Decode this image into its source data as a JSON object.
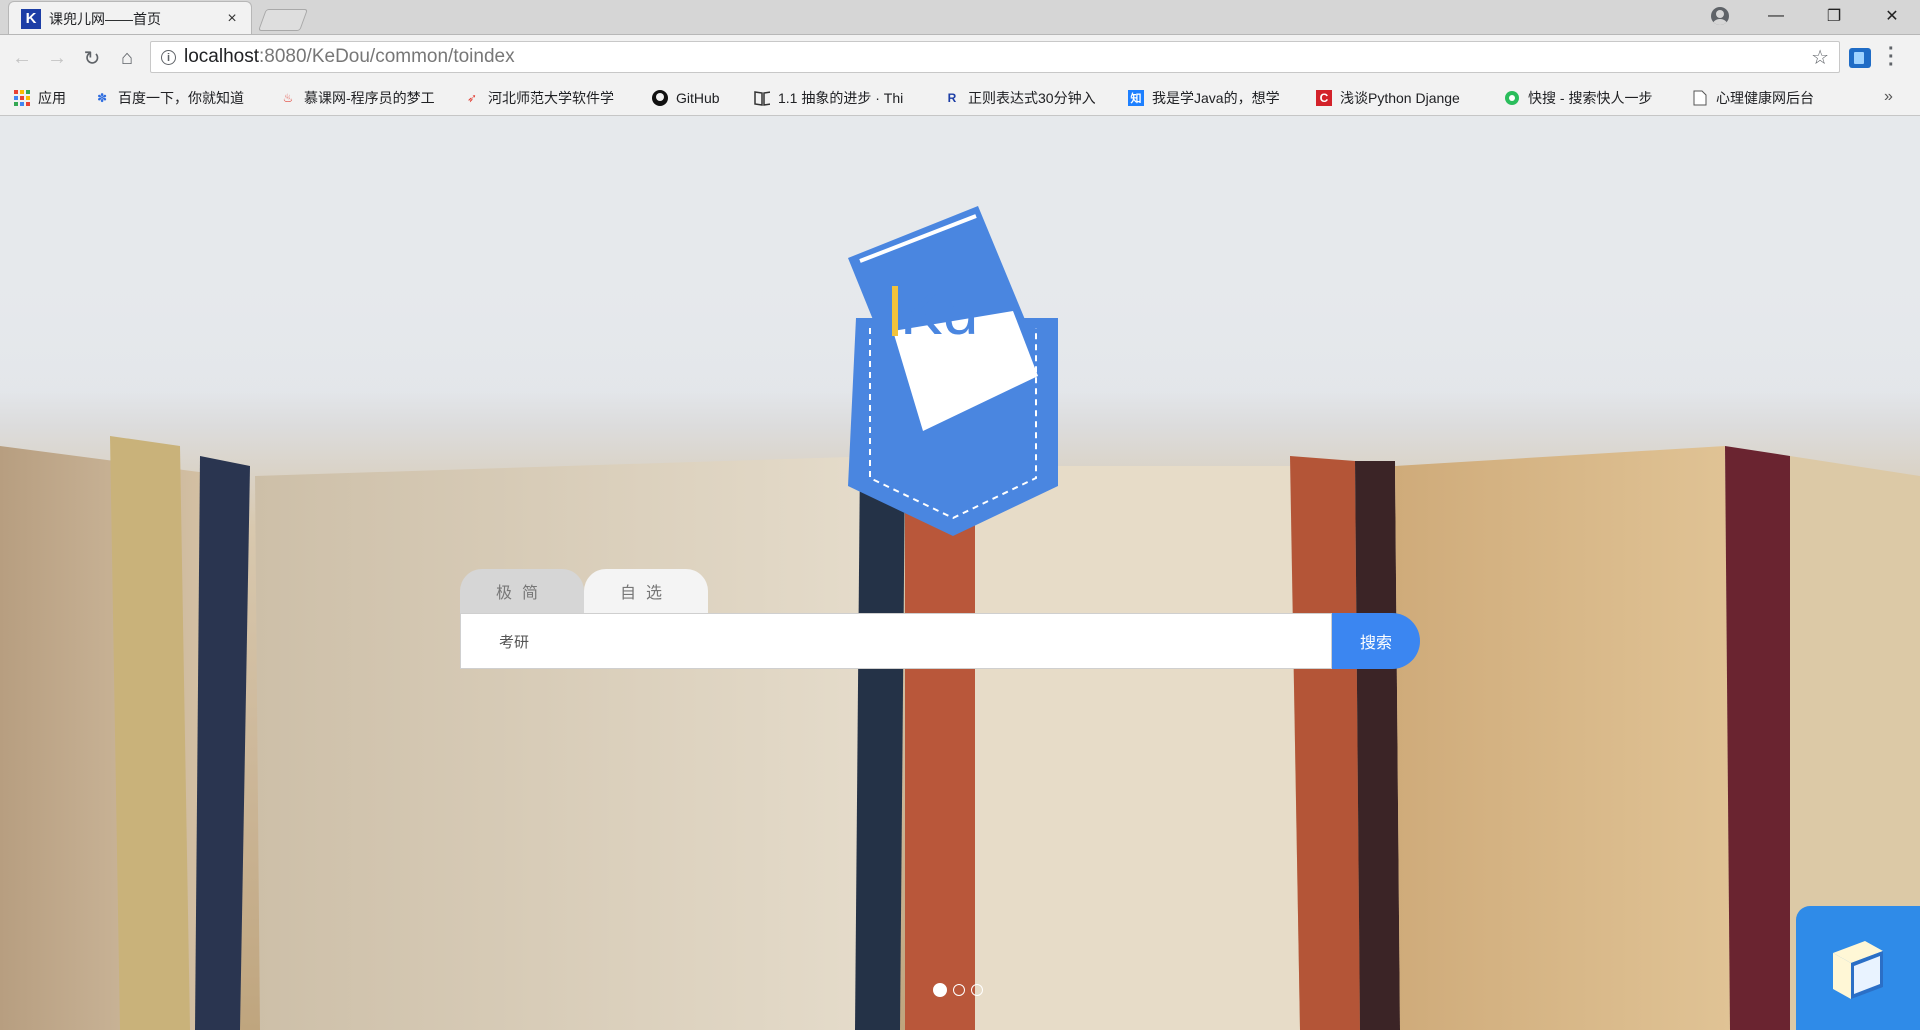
{
  "browser": {
    "tab_favicon": "K",
    "tab_title": "课兜儿网——首页",
    "tab_close": "×",
    "window_controls": {
      "minimize": "—",
      "restore": "❐",
      "close": "✕"
    },
    "url_host": "localhost",
    "url_rest": ":8080/KeDou/common/toindex",
    "icons": [
      "back-icon",
      "forward-icon",
      "reload-icon",
      "home-icon",
      "info-icon",
      "star-icon",
      "extension-icon",
      "menu-icon",
      "profile-icon"
    ]
  },
  "bookmarks": [
    {
      "label": "应用",
      "icon": "apps-grid-icon"
    },
    {
      "label": "百度一下，你就知道",
      "icon": "baidu-paw-icon"
    },
    {
      "label": "慕课网-程序员的梦工",
      "icon": "flame-icon"
    },
    {
      "label": "河北师范大学软件学",
      "icon": "rocket-icon"
    },
    {
      "label": "GitHub",
      "icon": "github-icon"
    },
    {
      "label": "1.1 抽象的进步 · Thi",
      "icon": "book-icon"
    },
    {
      "label": "正则表达式30分钟入",
      "icon": "r-icon"
    },
    {
      "label": "我是学Java的，想学",
      "icon": "zhihu-icon"
    },
    {
      "label": "浅谈Python Djange",
      "icon": "c-icon"
    },
    {
      "label": "快搜 - 搜索快人一步",
      "icon": "kuaisou-icon"
    },
    {
      "label": "心理健康网后台",
      "icon": "page-icon"
    }
  ],
  "bookmarks_more": "»",
  "logo": {
    "text": "Kd"
  },
  "search": {
    "tabs": [
      {
        "label": "极简",
        "active": true
      },
      {
        "label": "自选",
        "active": false
      }
    ],
    "input_value": "考研",
    "button_label": "搜索"
  },
  "carousel": {
    "count": 3,
    "active_index": 0
  },
  "colors": {
    "accent": "#3b86f1",
    "logo_blue": "#4a86e0",
    "widget_blue": "#2f8be8"
  }
}
